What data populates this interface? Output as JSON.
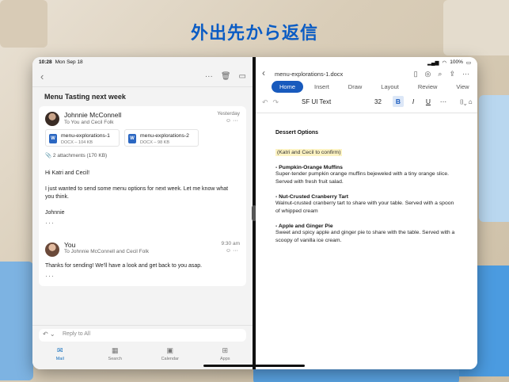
{
  "headline": "外出先から返信",
  "mail": {
    "status": {
      "time": "10:28",
      "date": "Mon Sep 18"
    },
    "toolbar": {
      "back": "‹",
      "more": "···",
      "trash": "🗑",
      "archive": "▭"
    },
    "subject": "Menu Tasting next week",
    "message1": {
      "from": "Johnnie McConnell",
      "to": "To You and Cecil Folk",
      "time": "Yesterday",
      "attachments": [
        {
          "name": "menu-explorations-1",
          "meta": "DOCX – 104 KB"
        },
        {
          "name": "menu-explorations-2",
          "meta": "DOCX – 98 KB"
        }
      ],
      "attachment_count": "2 attachments (170 KB)",
      "greeting": "Hi Katri and Cecil!",
      "body": "I just wanted to send some menu options for next week. Let me know what you think.",
      "signoff": "Johnnie"
    },
    "message2": {
      "from": "You",
      "to": "To Johnnie McConnell and Cecil Folk",
      "time": "9:30 am",
      "body": "Thanks for sending! We'll have a look and get back to you asap."
    },
    "reply_placeholder": "Reply to All",
    "tabs": [
      {
        "label": "Mail",
        "icon": "mail-icon"
      },
      {
        "label": "Search",
        "icon": "search-icon"
      },
      {
        "label": "Calendar",
        "icon": "calendar-icon"
      },
      {
        "label": "Apps",
        "icon": "apps-icon"
      }
    ]
  },
  "word": {
    "status": {
      "battery": "100%"
    },
    "filename": "menu-explorations-1.docx",
    "ribbon_tabs": [
      "Home",
      "Insert",
      "Draw",
      "Layout",
      "Review",
      "View"
    ],
    "font": "SF UI Text",
    "font_size": "32",
    "document": {
      "heading": "Dessert Options",
      "note": "(Katri and Cecil to confirm)",
      "items": [
        {
          "title": "- Pumpkin-Orange Muffins",
          "desc": "Super-tender pumpkin orange muffins bejeweled with a tiny orange slice. Served with fresh fruit salad."
        },
        {
          "title": "- Nut-Crusted Cranberry Tart",
          "desc": "Walnut-crusted cranberry tart to share with your table. Served with a spoon of whipped cream"
        },
        {
          "title": "- Apple and Ginger Pie",
          "desc": "Sweet and spicy apple and ginger pie to share with the table. Served with a scoopy of vanilla ice cream."
        }
      ]
    }
  }
}
